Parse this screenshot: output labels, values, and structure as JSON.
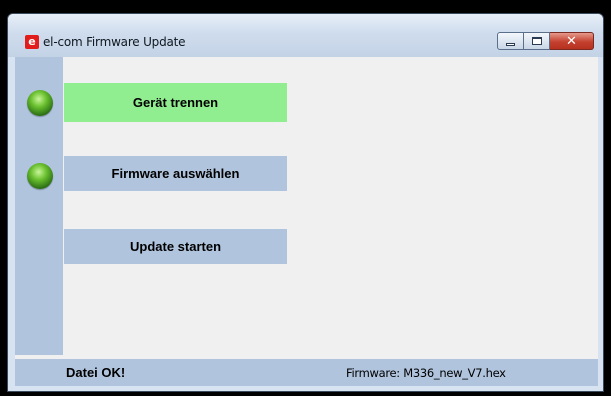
{
  "window": {
    "title": "el-com Firmware Update",
    "icon": "elcom-logo-icon",
    "icon_glyph": "e",
    "controls": {
      "minimize": "minimize-icon",
      "maximize": "maximize-icon",
      "close": "close-icon",
      "close_glyph": "✕"
    }
  },
  "indicators": [
    {
      "name": "status-led-1",
      "color": "#5cb82a",
      "state": "green"
    },
    {
      "name": "status-led-2",
      "color": "#5cb82a",
      "state": "green"
    }
  ],
  "actions": {
    "disconnect_label": "Gerät trennen",
    "disconnect_color": "#90ee90",
    "select_firmware_label": "Firmware auswählen",
    "start_update_label": "Update starten",
    "default_color": "#b0c4de"
  },
  "status": {
    "message": "Datei OK!",
    "firmware_text": "Firmware: M336_new_V7.hex"
  }
}
